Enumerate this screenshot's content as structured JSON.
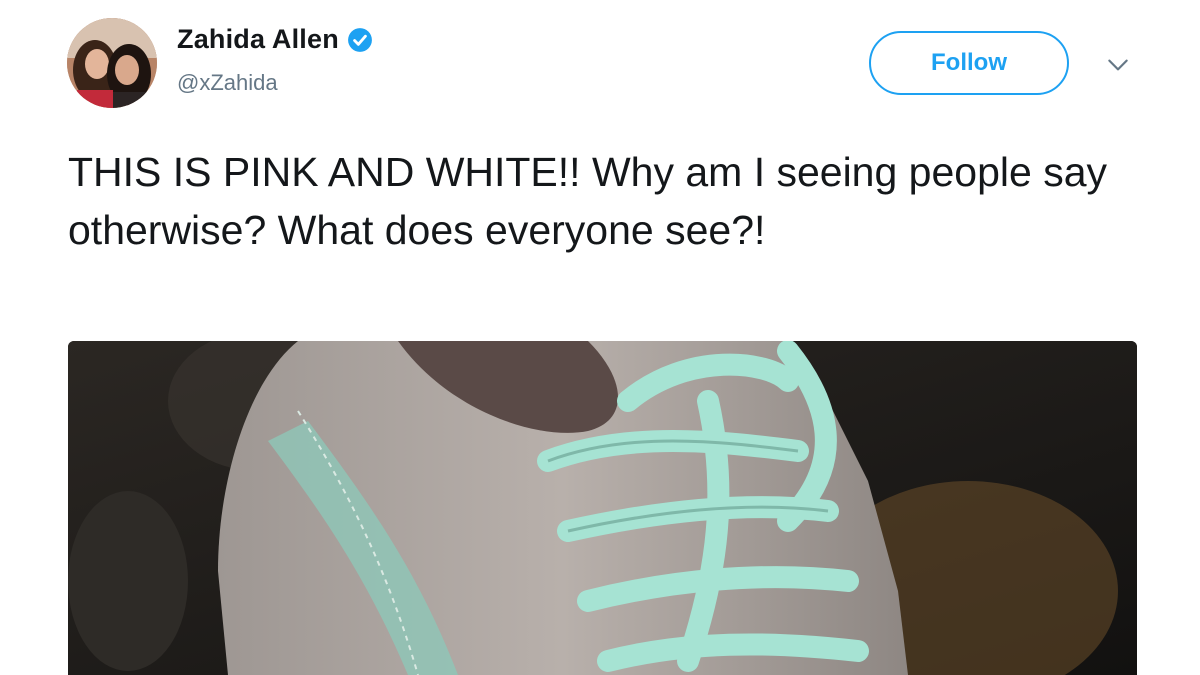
{
  "tweet": {
    "author": {
      "display_name": "Zahida Allen",
      "handle": "@xZahida",
      "verified": true,
      "avatar_icon": "profile-photo"
    },
    "follow_label": "Follow",
    "more_icon": "chevron-down-icon",
    "text": "THIS IS PINK AND WHITE!! Why am I seeing people say otherwise? What does everyone see?!",
    "media": {
      "kind": "photo",
      "subject": "sneaker-with-laces"
    }
  },
  "colors": {
    "accent": "#1da1f2",
    "text": "#14171a",
    "secondary_text": "#657786",
    "shoe_body": "#b3aca8",
    "shoe_stripe": "#8fc7b8",
    "laces": "#a6e3d3"
  }
}
